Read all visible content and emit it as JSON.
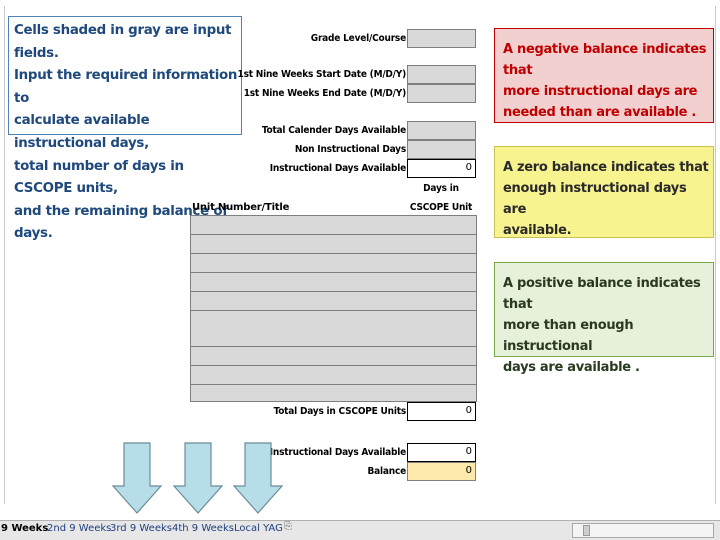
{
  "note_text": "Cells shaded in gray are input fields.\nInput the required information to\ncalculate available instructional days,\ntotal number of days in CSCOPE units,\nand the remaining balance of days.",
  "labels": {
    "grade_level": "Grade Level/Course",
    "start_date": "1st  Nine Weeks Start Date (M/D/Y)",
    "end_date": "1st  Nine Weeks  End Date  (M/D/Y)",
    "total_calendar": "Total Calender Days Available",
    "non_instructional": "Non Instructional Days",
    "instructional_available": "Instructional Days Available",
    "days_in": "Days in",
    "cscope_unit": "CSCOPE Unit",
    "unit_number_title": "Unit Number/Title",
    "total_days_cscope": "Total Days in CSCOPE Units",
    "instructional_available_2": "Instructional Days Available",
    "balance": "Balance"
  },
  "values": {
    "instructional_available": "0",
    "total_days_cscope": "0",
    "instructional_available_2": "0",
    "balance": "0"
  },
  "info_boxes": {
    "negative": "A negative balance indicates that\nmore instructional days are\nneeded than are available .",
    "zero": "A zero balance indicates that\nenough  instructional days are\navailable.",
    "positive": "A positive balance indicates that\nmore than enough instructional\ndays are available ."
  },
  "sheet_tabs": [
    "9 Weeks",
    "2nd 9 Weeks",
    "3rd 9 Weeks",
    "4th 9 Weeks",
    "Local YAG"
  ],
  "active_tab_index": 0,
  "colors": {
    "input_gray": "#d9d9d9",
    "balance_fill": "#fde9a9",
    "negative_box": "#f2d0d0",
    "zero_box": "#f7f38f",
    "positive_box": "#e6f0da",
    "arrow_fill": "#b7dde8"
  }
}
